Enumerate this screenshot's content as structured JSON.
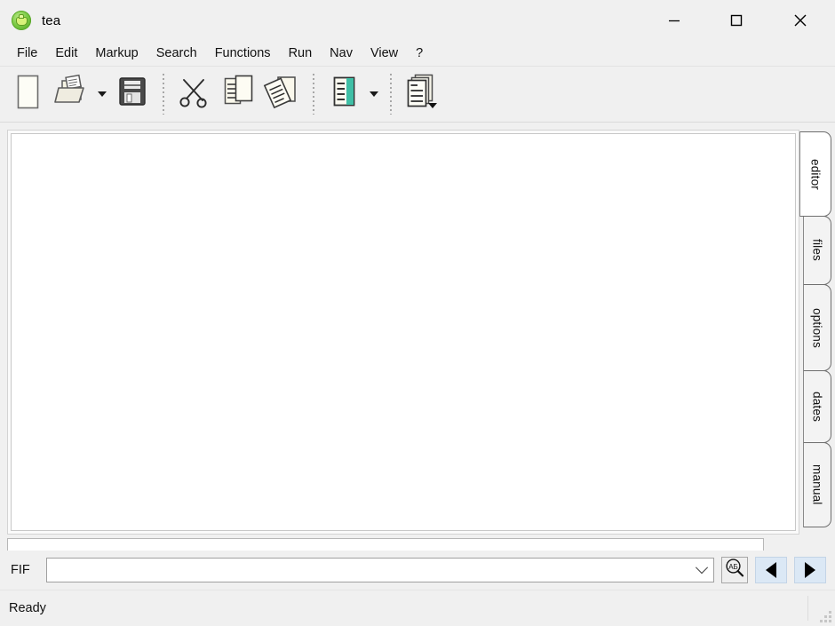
{
  "window": {
    "title": "tea",
    "icon": "teapot-icon",
    "minimize_label": "Minimize",
    "maximize_label": "Maximize",
    "close_label": "Close"
  },
  "menubar": {
    "items": [
      {
        "label": "File"
      },
      {
        "label": "Edit"
      },
      {
        "label": "Markup"
      },
      {
        "label": "Search"
      },
      {
        "label": "Functions"
      },
      {
        "label": "Run"
      },
      {
        "label": "Nav"
      },
      {
        "label": "View"
      },
      {
        "label": "?"
      }
    ]
  },
  "toolbar": {
    "buttons": [
      {
        "name": "new-document-button",
        "icon": "blank-page-icon",
        "label": "New"
      },
      {
        "name": "open-document-button",
        "icon": "open-folder-icon",
        "label": "Open",
        "has_dropdown": true
      },
      {
        "name": "save-document-button",
        "icon": "floppy-disk-icon",
        "label": "Save"
      },
      {
        "name": "cut-button",
        "icon": "scissors-icon",
        "label": "Cut"
      },
      {
        "name": "copy-button",
        "icon": "copy-pages-icon",
        "label": "Copy"
      },
      {
        "name": "paste-button",
        "icon": "paste-pages-icon",
        "label": "Paste"
      },
      {
        "name": "highlight-button",
        "icon": "highlight-document-icon",
        "label": "Markup",
        "has_dropdown": true
      },
      {
        "name": "documents-stack-button",
        "icon": "document-stack-icon",
        "label": "Documents",
        "has_dropdown": true
      }
    ]
  },
  "editor": {
    "content": "",
    "info_strip": "............................................................."
  },
  "tabs": {
    "items": [
      {
        "label": "editor",
        "active": true
      },
      {
        "label": "files",
        "active": false
      },
      {
        "label": "options",
        "active": false
      },
      {
        "label": "dates",
        "active": false
      },
      {
        "label": "manual",
        "active": false
      }
    ]
  },
  "fif": {
    "label": "FIF",
    "value": "",
    "placeholder": "",
    "search_button_label": "АБ",
    "prev_button_label": "◀",
    "next_button_label": "▶"
  },
  "statusbar": {
    "message": "Ready"
  },
  "colors": {
    "window_bg": "#f0f0f0",
    "editor_bg": "#ffffff",
    "accent_teal": "#3fbfa6",
    "nav_button_bg": "#dbe8f5",
    "icon_green": "#7ac943"
  }
}
